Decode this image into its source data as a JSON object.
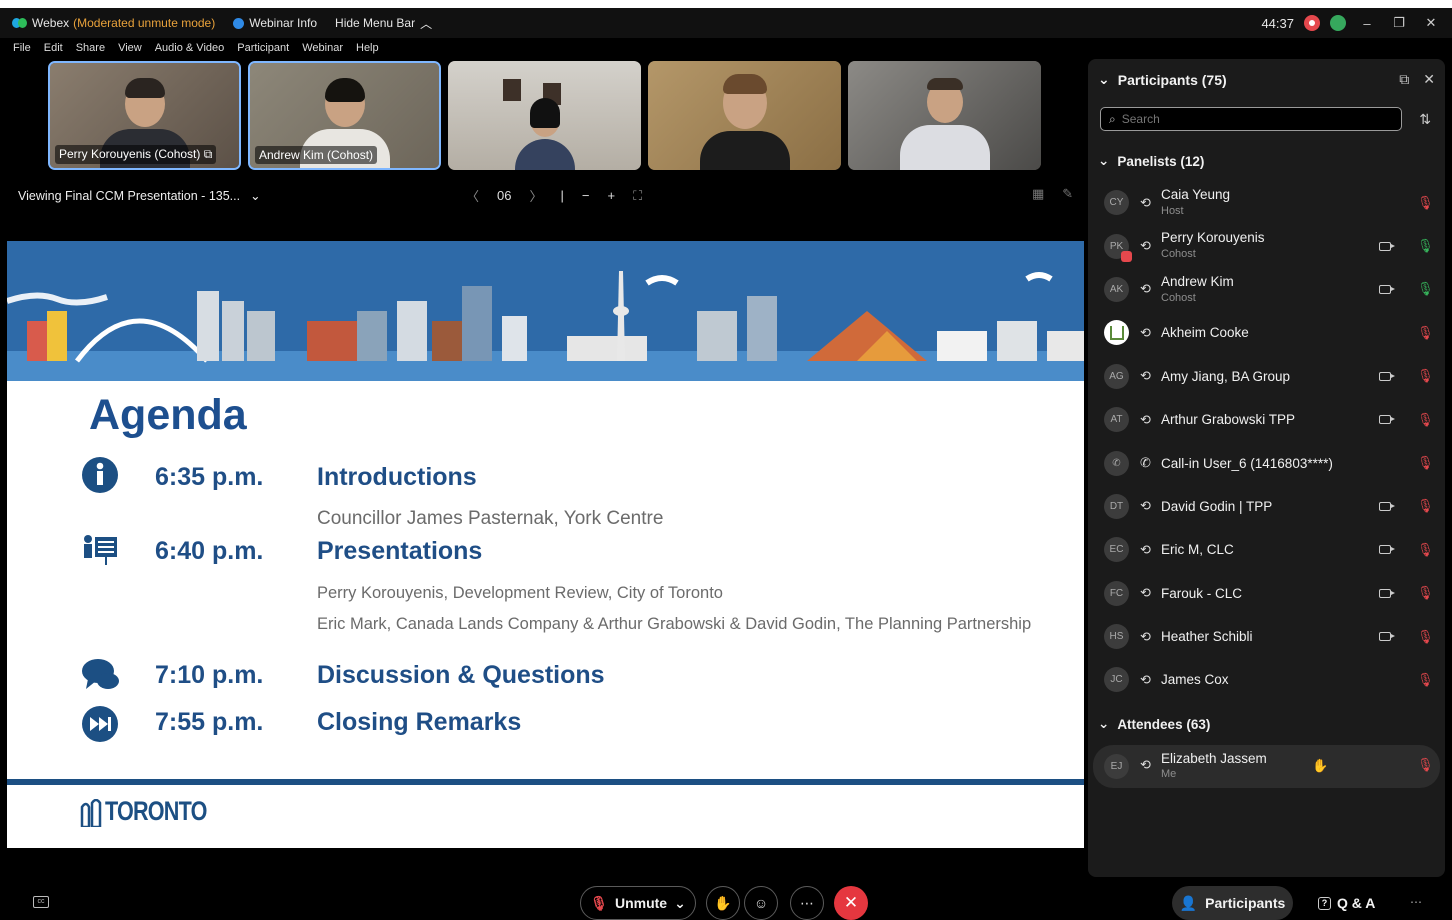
{
  "titlebar": {
    "app_name": "Webex",
    "mode": "(Moderated unmute mode)",
    "webinar_info": "Webinar Info",
    "hide_menu": "Hide Menu Bar",
    "timer": "44:37"
  },
  "menubar": [
    "File",
    "Edit",
    "Share",
    "View",
    "Audio & Video",
    "Participant",
    "Webinar",
    "Help"
  ],
  "videos": [
    {
      "label": "Perry Korouyenis (Cohost)"
    },
    {
      "label": "Andrew Kim (Cohost)"
    },
    {
      "label": ""
    },
    {
      "label": ""
    },
    {
      "label": ""
    }
  ],
  "viewing": {
    "text": "Viewing Final CCM Presentation - 135...",
    "page": "06"
  },
  "slide": {
    "title": "Agenda",
    "items": [
      {
        "time": "6:35 p.m.",
        "topic": "Introductions",
        "sub": [
          "Councillor James Pasternak, York Centre"
        ]
      },
      {
        "time": "6:40 p.m.",
        "topic": "Presentations",
        "sub": [
          "Perry Korouyenis, Development Review, City of Toronto",
          "Eric Mark, Canada Lands Company & Arthur Grabowski & David Godin, The Planning Partnership"
        ]
      },
      {
        "time": "7:10 p.m.",
        "topic": "Discussion & Questions",
        "sub": []
      },
      {
        "time": "7:55 p.m.",
        "topic": "Closing Remarks",
        "sub": []
      }
    ],
    "logo_text": "TORONTO"
  },
  "panel": {
    "title": "Participants (75)",
    "search_placeholder": "Search",
    "panelists_header": "Panelists (12)",
    "attendees_header": "Attendees (63)",
    "panelists": [
      {
        "initials": "CY",
        "name": "Caia Yeung",
        "role": "Host",
        "video": false,
        "mic": "muted"
      },
      {
        "initials": "PK",
        "name": "Perry Korouyenis",
        "role": "Cohost",
        "video": true,
        "mic": "on"
      },
      {
        "initials": "AK",
        "name": "Andrew Kim",
        "role": "Cohost",
        "video": true,
        "mic": "on"
      },
      {
        "initials": "",
        "name": "Akheim Cooke",
        "role": "",
        "video": false,
        "mic": "muted"
      },
      {
        "initials": "AG",
        "name": "Amy Jiang, BA Group",
        "role": "",
        "video": true,
        "mic": "muted"
      },
      {
        "initials": "AT",
        "name": "Arthur Grabowski TPP",
        "role": "",
        "video": true,
        "mic": "muted"
      },
      {
        "initials": "",
        "name": "Call-in User_6 (1416803****)",
        "role": "",
        "video": false,
        "mic": "muted"
      },
      {
        "initials": "DT",
        "name": "David Godin | TPP",
        "role": "",
        "video": true,
        "mic": "muted"
      },
      {
        "initials": "EC",
        "name": "Eric M, CLC",
        "role": "",
        "video": true,
        "mic": "muted"
      },
      {
        "initials": "FC",
        "name": "Farouk - CLC",
        "role": "",
        "video": true,
        "mic": "muted"
      },
      {
        "initials": "HS",
        "name": "Heather Schibli",
        "role": "",
        "video": true,
        "mic": "muted"
      },
      {
        "initials": "JC",
        "name": "James Cox",
        "role": "",
        "video": false,
        "mic": "muted"
      }
    ],
    "attendee_me": {
      "initials": "EJ",
      "name": "Elizabeth Jassem",
      "role": "Me"
    }
  },
  "bottombar": {
    "unmute": "Unmute",
    "participants": "Participants",
    "qa": "Q & A"
  },
  "colors": {
    "accent_blue": "#1d4f8f",
    "leave_red": "#e5373f",
    "muted_red": "#e5484d",
    "mic_green": "#36b35b"
  }
}
